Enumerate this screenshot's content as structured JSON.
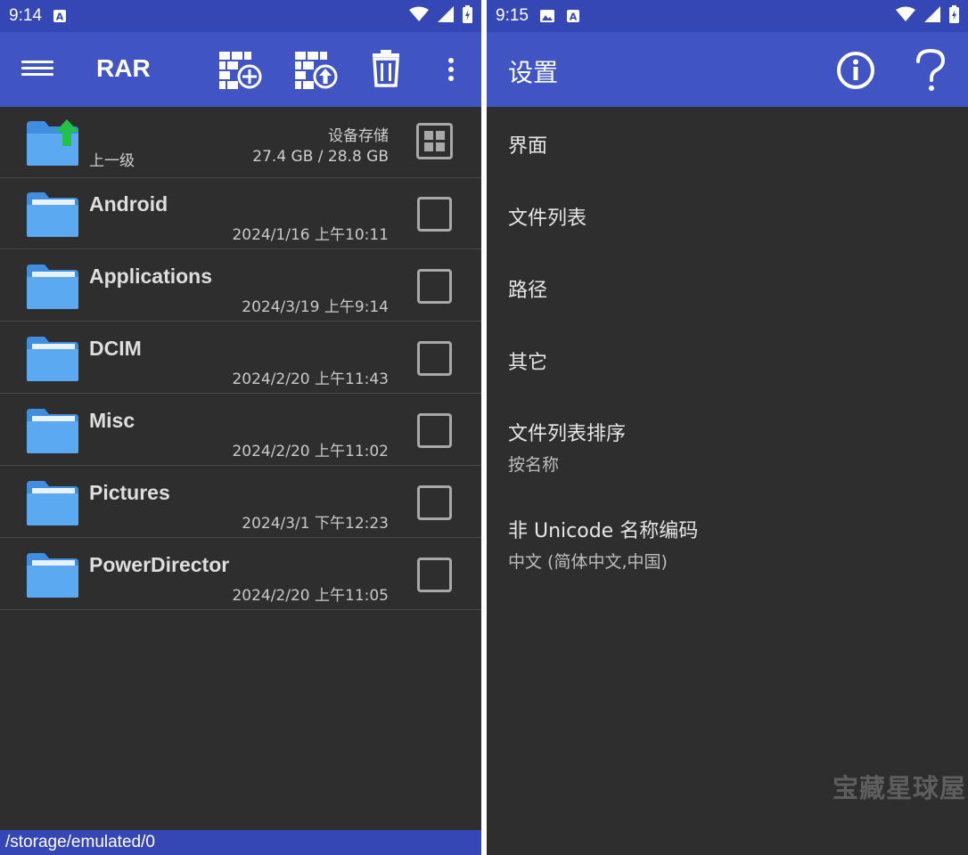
{
  "left": {
    "status": {
      "time": "9:14"
    },
    "appbar": {
      "title": "RAR"
    },
    "up_row": {
      "label": "上一级",
      "storage_name": "设备存储",
      "storage_size": "27.4 GB / 28.8 GB"
    },
    "folders": [
      {
        "name": "Android",
        "date": "2024/1/16 上午10:11"
      },
      {
        "name": "Applications",
        "date": "2024/3/19 上午9:14"
      },
      {
        "name": "DCIM",
        "date": "2024/2/20 上午11:43"
      },
      {
        "name": "Misc",
        "date": "2024/2/20 上午11:02"
      },
      {
        "name": "Pictures",
        "date": "2024/3/1 下午12:23"
      },
      {
        "name": "PowerDirector",
        "date": "2024/2/20 上午11:05"
      }
    ],
    "path": "/storage/emulated/0"
  },
  "right": {
    "status": {
      "time": "9:15"
    },
    "appbar": {
      "title": "设置"
    },
    "items": [
      {
        "label": "界面",
        "sub": ""
      },
      {
        "label": "文件列表",
        "sub": ""
      },
      {
        "label": "路径",
        "sub": ""
      },
      {
        "label": "其它",
        "sub": ""
      },
      {
        "label": "文件列表排序",
        "sub": "按名称"
      },
      {
        "label": "非 Unicode 名称编码",
        "sub": "中文 (简体中文,中国)"
      }
    ]
  },
  "watermark": "宝藏星球屋",
  "colors": {
    "statusbar": "#3546b5",
    "appbar": "#4154c3",
    "background": "#2e2e2f",
    "folder": "#5aa9f1",
    "up_arrow": "#22c24a"
  }
}
